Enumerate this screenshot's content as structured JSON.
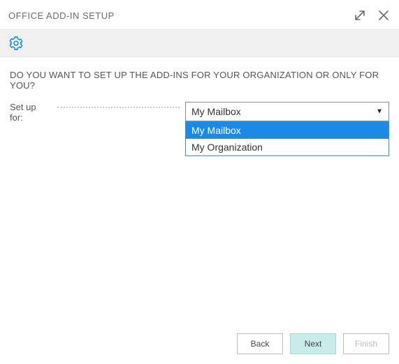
{
  "titlebar": {
    "title": "OFFICE ADD-IN SETUP"
  },
  "main": {
    "question": "DO YOU WANT TO SET UP THE ADD-INS FOR YOUR ORGANIZATION OR ONLY FOR YOU?",
    "label": "Set up for:",
    "select": {
      "value": "My Mailbox",
      "options": [
        "My Mailbox",
        "My Organization"
      ]
    }
  },
  "footer": {
    "back": "Back",
    "next": "Next",
    "finish": "Finish"
  }
}
